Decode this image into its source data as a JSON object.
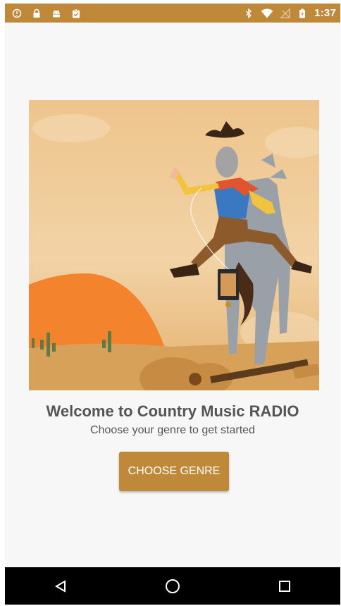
{
  "status_bar": {
    "time": "1:37",
    "left_icons": [
      "info-icon",
      "lock-icon",
      "android-icon",
      "clipboard-check-icon"
    ],
    "right_icons": [
      "bluetooth-icon",
      "wifi-icon",
      "no-signal-icon",
      "battery-icon"
    ],
    "background": "#c0893a"
  },
  "main": {
    "title": "Welcome to Country Music RADIO",
    "subtitle": "Choose your genre to get started",
    "button_label": "CHOOSE GENRE"
  },
  "nav_bar": {
    "buttons": [
      "back-icon",
      "home-icon",
      "recents-icon"
    ]
  },
  "colors": {
    "accent": "#c0893a",
    "text": "#555555",
    "sun": "#f4832e"
  }
}
